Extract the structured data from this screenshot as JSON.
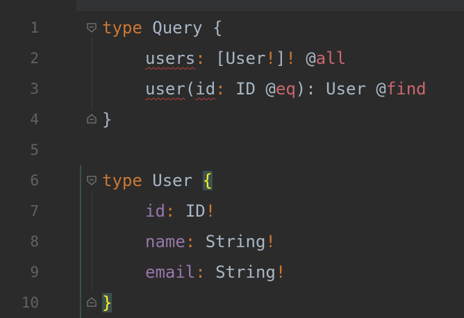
{
  "line_numbers": [
    "1",
    "2",
    "3",
    "4",
    "5",
    "6",
    "7",
    "8",
    "9",
    "10"
  ],
  "code": {
    "l1": {
      "kw": "type",
      "name": " Query ",
      "brace": "{"
    },
    "l2": {
      "field": "users",
      "colon": ": ",
      "lbr": "[",
      "type": "User",
      "bang": "!",
      "rbr": "]",
      "bang2": "!",
      "sp": " ",
      "at": "@",
      "dir": "all"
    },
    "l3": {
      "field": "user",
      "paren": "(",
      "arg": "id",
      "colon": ": ",
      "type": "ID ",
      "at": "@",
      "dir": "eq",
      "close": "): User ",
      "at2": "@",
      "dir2": "find"
    },
    "l4": {
      "brace": "}"
    },
    "l6": {
      "kw": "type",
      "name": " User ",
      "brace": "{"
    },
    "l7": {
      "field": "id",
      "colon": ": ",
      "type": "ID",
      "bang": "!"
    },
    "l8": {
      "field": "name",
      "colon": ": ",
      "type": "String",
      "bang": "!"
    },
    "l9": {
      "field": "email",
      "colon": ": ",
      "type": "String",
      "bang": "!"
    },
    "l10": {
      "brace": "}"
    }
  },
  "colors": {
    "background": "#2b2b2b",
    "keyword": "#cc7832",
    "directive": "#cc666e",
    "field": "#9876aa",
    "plain": "#a9b7c6",
    "brace_highlight": "#ffef28"
  },
  "icons": [
    "fold-open-icon",
    "fold-close-icon"
  ]
}
